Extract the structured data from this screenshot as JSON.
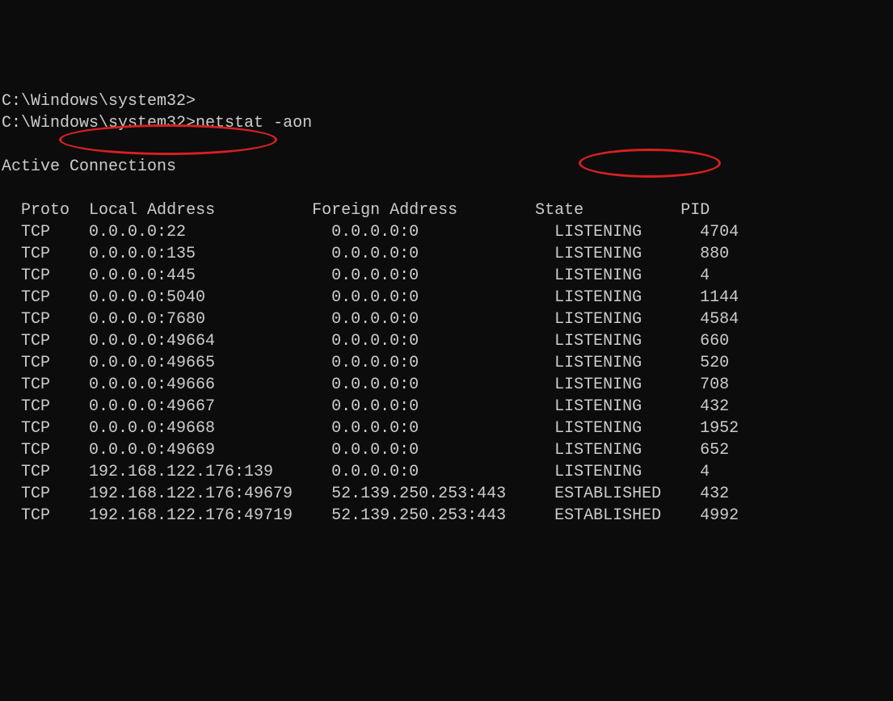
{
  "prompt1": "C:\\Windows\\system32>",
  "prompt2": "C:\\Windows\\system32>",
  "command": "netstat -aon",
  "heading": "Active Connections",
  "headers": {
    "proto": "Proto",
    "local": "Local Address",
    "foreign": "Foreign Address",
    "state": "State",
    "pid": "PID"
  },
  "rows": [
    {
      "proto": "TCP",
      "local": "0.0.0.0:22",
      "foreign": "0.0.0.0:0",
      "state": "LISTENING",
      "pid": "4704"
    },
    {
      "proto": "TCP",
      "local": "0.0.0.0:135",
      "foreign": "0.0.0.0:0",
      "state": "LISTENING",
      "pid": "880"
    },
    {
      "proto": "TCP",
      "local": "0.0.0.0:445",
      "foreign": "0.0.0.0:0",
      "state": "LISTENING",
      "pid": "4"
    },
    {
      "proto": "TCP",
      "local": "0.0.0.0:5040",
      "foreign": "0.0.0.0:0",
      "state": "LISTENING",
      "pid": "1144"
    },
    {
      "proto": "TCP",
      "local": "0.0.0.0:7680",
      "foreign": "0.0.0.0:0",
      "state": "LISTENING",
      "pid": "4584"
    },
    {
      "proto": "TCP",
      "local": "0.0.0.0:49664",
      "foreign": "0.0.0.0:0",
      "state": "LISTENING",
      "pid": "660"
    },
    {
      "proto": "TCP",
      "local": "0.0.0.0:49665",
      "foreign": "0.0.0.0:0",
      "state": "LISTENING",
      "pid": "520"
    },
    {
      "proto": "TCP",
      "local": "0.0.0.0:49666",
      "foreign": "0.0.0.0:0",
      "state": "LISTENING",
      "pid": "708"
    },
    {
      "proto": "TCP",
      "local": "0.0.0.0:49667",
      "foreign": "0.0.0.0:0",
      "state": "LISTENING",
      "pid": "432"
    },
    {
      "proto": "TCP",
      "local": "0.0.0.0:49668",
      "foreign": "0.0.0.0:0",
      "state": "LISTENING",
      "pid": "1952"
    },
    {
      "proto": "TCP",
      "local": "0.0.0.0:49669",
      "foreign": "0.0.0.0:0",
      "state": "LISTENING",
      "pid": "652"
    },
    {
      "proto": "TCP",
      "local": "192.168.122.176:139",
      "foreign": "0.0.0.0:0",
      "state": "LISTENING",
      "pid": "4"
    },
    {
      "proto": "TCP",
      "local": "192.168.122.176:49679",
      "foreign": "52.139.250.253:443",
      "state": "ESTABLISHED",
      "pid": "432"
    },
    {
      "proto": "TCP",
      "local": "192.168.122.176:49719",
      "foreign": "52.139.250.253:443",
      "state": "ESTABLISHED",
      "pid": "4992"
    }
  ]
}
